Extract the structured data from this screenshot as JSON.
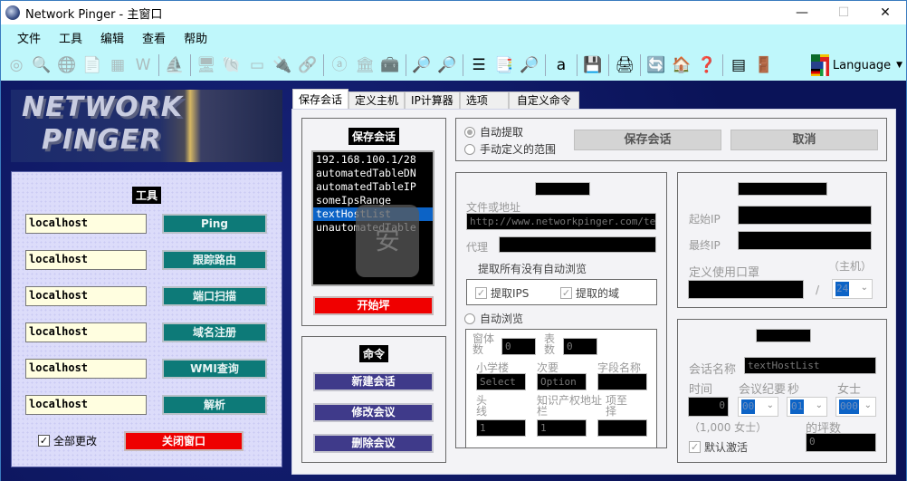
{
  "window": {
    "title": "Network Pinger - 主窗口",
    "controls": {
      "minimize": "—",
      "maximize": "☐",
      "close": "✕"
    }
  },
  "menu": [
    "文件",
    "工具",
    "编辑",
    "查看",
    "帮助"
  ],
  "toolbar": {
    "icons": [
      {
        "name": "ping-target-icon",
        "glyph": "◎",
        "enabled": false
      },
      {
        "name": "search-globe-icon",
        "glyph": "🔍",
        "enabled": false
      },
      {
        "name": "www-icon",
        "glyph": "🌐",
        "enabled": false
      },
      {
        "name": "document-search-icon",
        "glyph": "📄",
        "enabled": false
      },
      {
        "name": "grid-icon",
        "glyph": "▦",
        "enabled": false
      },
      {
        "name": "wmi-icon",
        "glyph": "W",
        "enabled": false
      },
      {
        "sep": true
      },
      {
        "name": "ship-icon",
        "glyph": "⛵",
        "enabled": false
      },
      {
        "sep": true
      },
      {
        "name": "network-computer-icon",
        "glyph": "🖥",
        "enabled": false
      },
      {
        "name": "shell-icon",
        "glyph": "🐚",
        "enabled": false
      },
      {
        "name": "terminal-icon",
        "glyph": "▭",
        "enabled": false
      },
      {
        "name": "plug-icon",
        "glyph": "🔌",
        "enabled": false
      },
      {
        "name": "connector-icon",
        "glyph": "🔗",
        "enabled": false
      },
      {
        "sep": true
      },
      {
        "name": "letter-a-icon",
        "glyph": "ⓐ",
        "enabled": false
      },
      {
        "name": "bank-icon",
        "glyph": "🏛",
        "enabled": false
      },
      {
        "name": "tools-icon",
        "glyph": "🧰",
        "enabled": false
      },
      {
        "sep": true
      },
      {
        "name": "zoom-out-icon",
        "glyph": "🔎",
        "enabled": true
      },
      {
        "name": "zoom-info-icon",
        "glyph": "🔎",
        "enabled": true
      },
      {
        "sep": true
      },
      {
        "name": "list-icon",
        "glyph": "☰",
        "enabled": true
      },
      {
        "name": "copy-icon",
        "glyph": "📑",
        "enabled": true
      },
      {
        "name": "find-icon",
        "glyph": "🔎",
        "enabled": true
      },
      {
        "sep": true
      },
      {
        "name": "font-icon",
        "glyph": "a",
        "enabled": true
      },
      {
        "sep": true
      },
      {
        "name": "save-icon",
        "glyph": "💾",
        "enabled": true
      },
      {
        "sep": true
      },
      {
        "name": "print-icon",
        "glyph": "🖨",
        "enabled": true
      },
      {
        "sep": true
      },
      {
        "name": "refresh-icon",
        "glyph": "🔄",
        "enabled": true
      },
      {
        "name": "home-icon",
        "glyph": "🏠",
        "enabled": true
      },
      {
        "name": "help-icon",
        "glyph": "❓",
        "enabled": true
      },
      {
        "sep": true
      },
      {
        "name": "screen-icon",
        "glyph": "▤",
        "enabled": true
      },
      {
        "name": "exit-icon",
        "glyph": "🚪",
        "enabled": true
      }
    ],
    "language_label": "Language"
  },
  "banner": {
    "line1": "NETWORK",
    "line2": "PINGER"
  },
  "tools": {
    "title": "工具",
    "rows": [
      {
        "host": "localhost",
        "button": "Ping"
      },
      {
        "host": "localhost",
        "button": "跟踪路由"
      },
      {
        "host": "localhost",
        "button": "端口扫描"
      },
      {
        "host": "localhost",
        "button": "域名注册"
      },
      {
        "host": "localhost",
        "button": "WMI查询"
      },
      {
        "host": "localhost",
        "button": "解析"
      }
    ],
    "change_all_label": "全部更改",
    "change_all_checked": true,
    "close_window": "关闭窗口"
  },
  "tabs": [
    "保存会话",
    "定义主机",
    "IP计算器",
    "选项",
    "自定义命令"
  ],
  "active_tab": 0,
  "saved_sessions": {
    "title": "保存会话",
    "items": [
      "192.168.100.1/28",
      "automatedTableDN",
      "automatedTableIP",
      "someIpsRange",
      "textHostList",
      "unautomatedTable"
    ],
    "selected": 4,
    "start_button": "开始坪"
  },
  "commands": {
    "title": "命令",
    "buttons": [
      "新建会话",
      "修改会议",
      "删除会议"
    ]
  },
  "top_options": {
    "radio_auto": "自动提取",
    "radio_manual": "手动定义的范围",
    "save_session": "保存会话",
    "cancel": "取消"
  },
  "file_section": {
    "file_label": "文件或地址",
    "file_value": "http://www.networkpinger.com/testin",
    "proxy_label": "代理",
    "extract_all_label": "提取所有没有自动浏览",
    "extract_ips": "提取IPS",
    "extract_domains": "提取的域",
    "auto_browse": "自动浏览",
    "window_count_label": "窗体数",
    "window_count": "0",
    "table_count_label": "表数",
    "table_count": "0",
    "school_label": "小学楼",
    "school_value": "Select",
    "secondary_label": "次要",
    "secondary_value": "Option",
    "field_name_label": "字段名称",
    "head_line_label": "头线",
    "head_line_value": "1",
    "ip_addr_col_label": "知识产权地址栏",
    "ip_addr_col_value": "1",
    "item_select_label": "项至择"
  },
  "range_section": {
    "start_ip_label": "起始IP",
    "end_ip_label": "最终IP",
    "define_label": "定义使用口罩",
    "hosts_label": "（主机）",
    "slash": "/",
    "mask_value": "24"
  },
  "session_section": {
    "name_label": "会话名称",
    "name_value": "textHostList",
    "time_label": "时间",
    "minutes_label": "会议纪要",
    "seconds_label": "秒",
    "ms_label": "女士",
    "time_value": "0",
    "minutes_value": "00",
    "seconds_value": "01",
    "ms_value": "000",
    "ms_note": "（1,000 女士）",
    "ping_count_label": "的坪数",
    "ping_count_value": "0",
    "default_active_label": "默认激活",
    "default_active_checked": true
  }
}
